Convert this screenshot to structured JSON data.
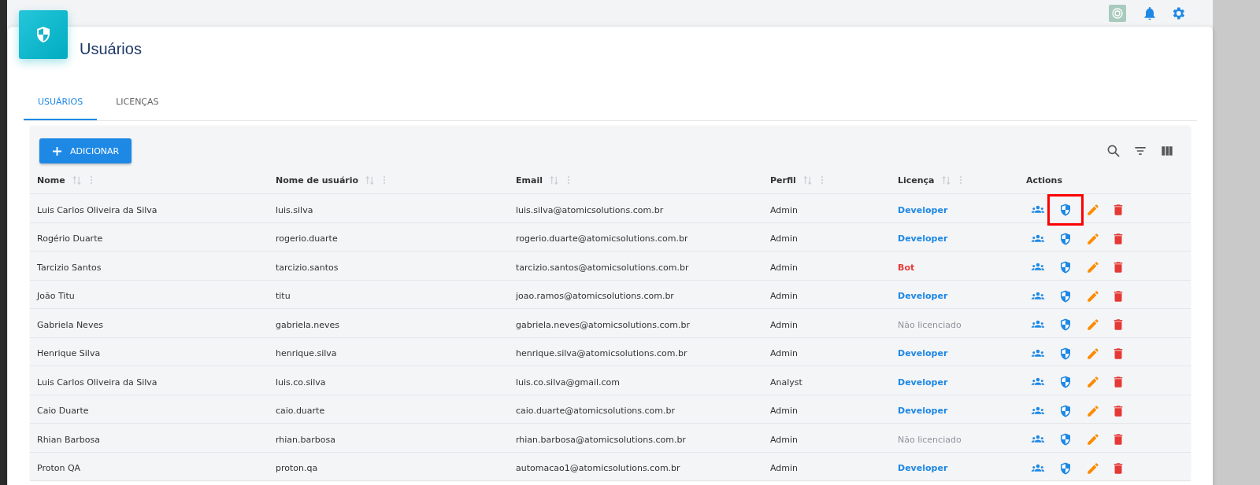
{
  "page": {
    "title": "Usuários"
  },
  "tabs": [
    {
      "label": "USUÁRIOS",
      "selected": true
    },
    {
      "label": "LICENÇAS",
      "selected": false
    }
  ],
  "add_button": {
    "label": "ADICIONAR"
  },
  "table": {
    "columns": [
      {
        "label": "Nome",
        "sortable": true
      },
      {
        "label": "Nome de usuário",
        "sortable": true
      },
      {
        "label": "Email",
        "sortable": true
      },
      {
        "label": "Perfil",
        "sortable": true
      },
      {
        "label": "Licença",
        "sortable": true
      },
      {
        "label": "Actions",
        "sortable": false
      }
    ],
    "rows": [
      {
        "name": "Luis Carlos Oliveira da Silva",
        "username": "luis.silva",
        "email": "luis.silva@atomicsolutions.com.br",
        "profile": "Admin",
        "license": "Developer",
        "kind": "developer",
        "highlighted": true
      },
      {
        "name": "Rogério Duarte",
        "username": "rogerio.duarte",
        "email": "rogerio.duarte@atomicsolutions.com.br",
        "profile": "Admin",
        "license": "Developer",
        "kind": "developer",
        "highlighted": false
      },
      {
        "name": "Tarcizio Santos",
        "username": "tarcizio.santos",
        "email": "tarcizio.santos@atomicsolutions.com.br",
        "profile": "Admin",
        "license": "Bot",
        "kind": "bot",
        "highlighted": false
      },
      {
        "name": "João Titu",
        "username": "titu",
        "email": "joao.ramos@atomicsolutions.com.br",
        "profile": "Admin",
        "license": "Developer",
        "kind": "developer",
        "highlighted": false
      },
      {
        "name": "Gabriela Neves",
        "username": "gabriela.neves",
        "email": "gabriela.neves@atomicsolutions.com.br",
        "profile": "Admin",
        "license": "Não licenciado",
        "kind": "none",
        "highlighted": false
      },
      {
        "name": "Henrique Silva",
        "username": "henrique.silva",
        "email": "henrique.silva@atomicsolutions.com.br",
        "profile": "Admin",
        "license": "Developer",
        "kind": "developer",
        "highlighted": false
      },
      {
        "name": "Luis Carlos Oliveira da Silva",
        "username": "luis.co.silva",
        "email": "luis.co.silva@gmail.com",
        "profile": "Analyst",
        "license": "Developer",
        "kind": "developer",
        "highlighted": false
      },
      {
        "name": "Caio Duarte",
        "username": "caio.duarte",
        "email": "caio.duarte@atomicsolutions.com.br",
        "profile": "Admin",
        "license": "Developer",
        "kind": "developer",
        "highlighted": false
      },
      {
        "name": "Rhian Barbosa",
        "username": "rhian.barbosa",
        "email": "rhian.barbosa@atomicsolutions.com.br",
        "profile": "Admin",
        "license": "Não licenciado",
        "kind": "none",
        "highlighted": false
      },
      {
        "name": "Proton QA",
        "username": "proton.qa",
        "email": "automacao1@atomicsolutions.com.br",
        "profile": "Admin",
        "license": "Developer",
        "kind": "developer",
        "highlighted": false
      }
    ]
  }
}
